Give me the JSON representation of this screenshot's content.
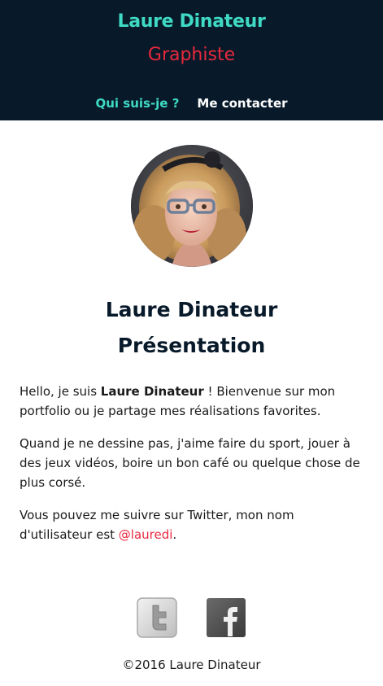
{
  "header": {
    "name": "Laure Dinateur",
    "role": "Graphiste"
  },
  "nav": {
    "items": [
      {
        "label": "Qui suis-je ?",
        "active": true
      },
      {
        "label": "Me contacter",
        "active": false
      }
    ]
  },
  "profile": {
    "title_line1": "Laure Dinateur",
    "title_line2": "Présentation"
  },
  "content": {
    "p1_before": "Hello, je suis ",
    "p1_bold": "Laure Dinateur",
    "p1_after": " ! Bienvenue sur mon portfolio ou je partage mes réalisations favorites.",
    "p2": "Quand je ne dessine pas, j'aime faire du sport, jouer à des jeux vidéos, boire un bon café ou quelque chose de plus corsé.",
    "p3_before": "Vous pouvez me suivre sur Twitter, mon nom d'utilisateur est ",
    "p3_link": "@lauredi",
    "p3_after": "."
  },
  "social": {
    "twitter_icon": "twitter-icon",
    "facebook_icon": "facebook-icon"
  },
  "footer": {
    "copyright": "©2016 Laure Dinateur"
  },
  "colors": {
    "header_bg": "#081a2a",
    "accent_teal": "#3fd9c4",
    "accent_red": "#e8283c"
  }
}
